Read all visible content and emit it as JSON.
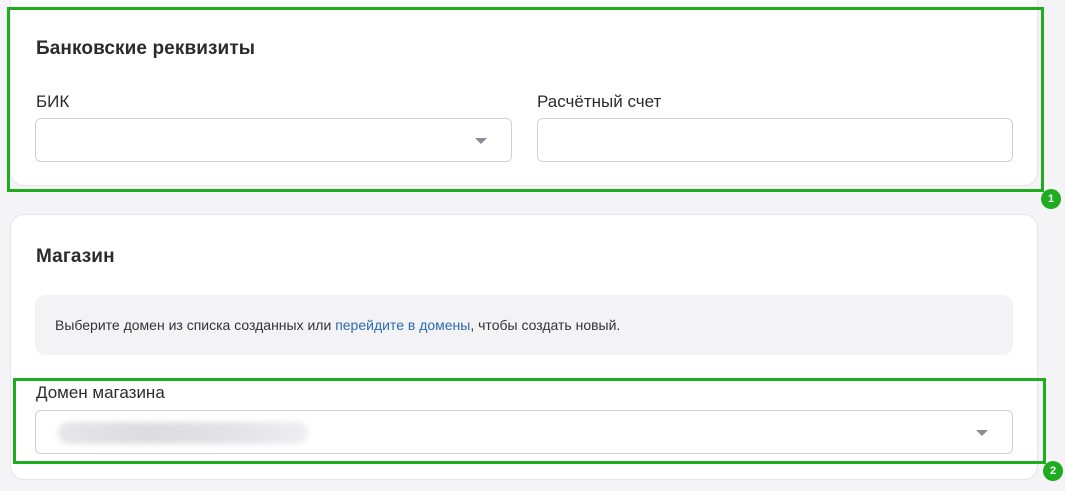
{
  "bank_section": {
    "title": "Банковские реквизиты",
    "bik_label": "БИК",
    "bik_value": "",
    "account_label": "Расчётный счет",
    "account_value": ""
  },
  "shop_section": {
    "title": "Магазин",
    "info_text_before": "Выберите домен из списка созданных или ",
    "info_link": "перейдите в домены",
    "info_text_after": ", чтобы создать новый.",
    "domain_label": "Домен магазина"
  },
  "annotations": {
    "badge_1": "1",
    "badge_2": "2",
    "color": "#1fad1f"
  },
  "colors": {
    "link": "#2b6bb0",
    "background": "#f4f4f6"
  }
}
